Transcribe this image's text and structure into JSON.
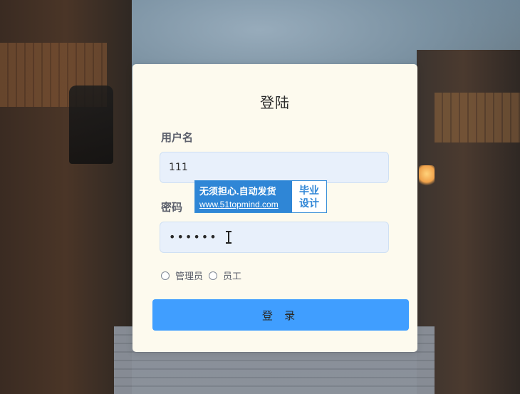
{
  "form": {
    "title": "登陆",
    "username_label": "用户名",
    "username_value": "111",
    "password_label": "密码",
    "password_masked": "••••••",
    "roles": [
      {
        "label": "管理员",
        "checked": false
      },
      {
        "label": "员工",
        "checked": false
      }
    ],
    "submit_label": "登 录",
    "colors": {
      "card_bg": "#fdfaee",
      "input_bg": "#e8f0fb",
      "submit_bg": "#409eff"
    }
  },
  "watermark": {
    "line1": "无须担心.自动发货",
    "line2": "www.51topmind.com",
    "side1": "毕业",
    "side2": "设计"
  },
  "icons": {
    "text_cursor": "ibeam-cursor-icon",
    "radio": "radio-icon"
  }
}
